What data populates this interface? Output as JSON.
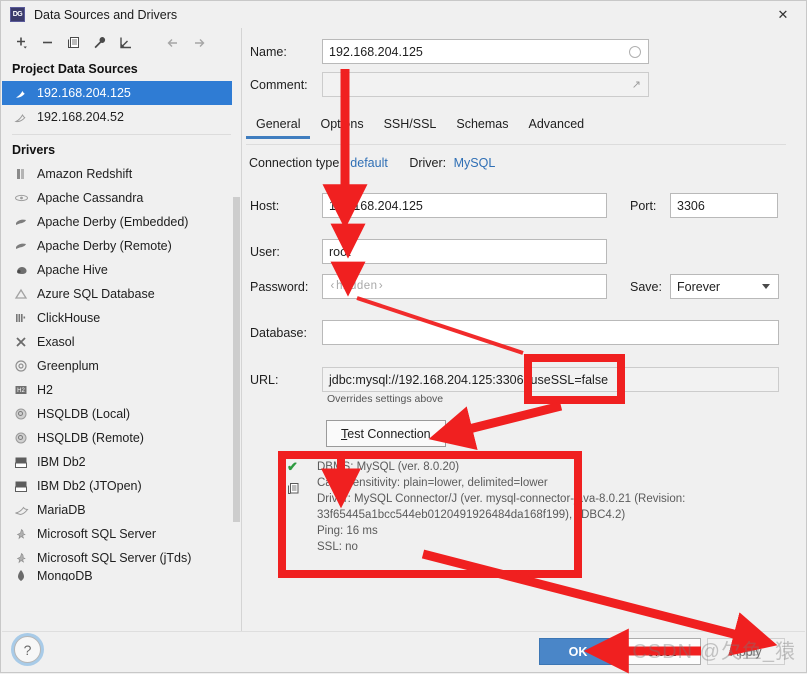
{
  "window": {
    "title": "Data Sources and Drivers",
    "app_icon_label": "DG",
    "close_label": "✕"
  },
  "left_panel": {
    "toolbar": [
      {
        "name": "add-button",
        "glyph": "+"
      },
      {
        "name": "remove-button",
        "glyph": "−"
      },
      {
        "name": "copy-button",
        "glyph": "❐"
      },
      {
        "name": "properties-button",
        "glyph": "🔧"
      },
      {
        "name": "import-button",
        "glyph": "↙"
      },
      {
        "name": "back-button",
        "glyph": "←"
      },
      {
        "name": "forward-button",
        "glyph": "→"
      }
    ],
    "project_data_sources_header": "Project Data Sources",
    "data_sources": [
      {
        "label": "192.168.204.125",
        "selected": true
      },
      {
        "label": "192.168.204.52",
        "selected": false
      }
    ],
    "drivers_header": "Drivers",
    "drivers": [
      {
        "label": "Amazon Redshift",
        "icon": "redshift-icon"
      },
      {
        "label": "Apache Cassandra",
        "icon": "cassandra-icon"
      },
      {
        "label": "Apache Derby (Embedded)",
        "icon": "derby-icon"
      },
      {
        "label": "Apache Derby (Remote)",
        "icon": "derby-icon"
      },
      {
        "label": "Apache Hive",
        "icon": "hive-icon"
      },
      {
        "label": "Azure SQL Database",
        "icon": "azure-icon"
      },
      {
        "label": "ClickHouse",
        "icon": "clickhouse-icon"
      },
      {
        "label": "Exasol",
        "icon": "exasol-icon"
      },
      {
        "label": "Greenplum",
        "icon": "greenplum-icon"
      },
      {
        "label": "H2",
        "icon": "h2-icon"
      },
      {
        "label": "HSQLDB (Local)",
        "icon": "hsqldb-icon"
      },
      {
        "label": "HSQLDB (Remote)",
        "icon": "hsqldb-icon"
      },
      {
        "label": "IBM Db2",
        "icon": "db2-icon"
      },
      {
        "label": "IBM Db2 (JTOpen)",
        "icon": "db2-icon"
      },
      {
        "label": "MariaDB",
        "icon": "mariadb-icon"
      },
      {
        "label": "Microsoft SQL Server",
        "icon": "mssql-icon"
      },
      {
        "label": "Microsoft SQL Server (jTds)",
        "icon": "mssql-icon"
      },
      {
        "label": "MongoDB",
        "icon": "mongodb-icon"
      }
    ]
  },
  "form": {
    "name_label": "Name:",
    "name_value": "192.168.204.125",
    "comment_label": "Comment:",
    "comment_value": "",
    "tabs": [
      {
        "label": "General",
        "active": true
      },
      {
        "label": "Options",
        "active": false
      },
      {
        "label": "SSH/SSL",
        "active": false
      },
      {
        "label": "Schemas",
        "active": false
      },
      {
        "label": "Advanced",
        "active": false
      }
    ],
    "connection_type_label": "Connection type:",
    "connection_type_value": "default",
    "driver_label": "Driver:",
    "driver_value": "MySQL",
    "host_label": "Host:",
    "host_value": "192.168.204.125",
    "port_label": "Port:",
    "port_value": "3306",
    "user_label": "User:",
    "user_value": "root",
    "password_label": "Password:",
    "password_placeholder": "‹hidden›",
    "save_label": "Save:",
    "save_value": "Forever",
    "database_label": "Database:",
    "database_value": "",
    "url_label": "URL:",
    "url_value": "jdbc:mysql://192.168.204.125:3306?useSSL=false",
    "url_hint": "Overrides settings above",
    "test_connection_label": "Test Connection"
  },
  "result": {
    "status_icon": "✔",
    "copy_icon": "❐",
    "lines": [
      "DBMS: MySQL (ver. 8.0.20)",
      "Case sensitivity: plain=lower, delimited=lower",
      "Driver: MySQL Connector/J (ver. mysql-connector-java-8.0.21 (Revision:",
      "33f65445a1bcc544eb0120491926484da168f199), JDBC4.2)",
      "Ping: 16 ms",
      "SSL: no"
    ]
  },
  "footer": {
    "help_label": "?",
    "ok_label": "OK",
    "close_label": "Close",
    "apply_label": "Apply"
  },
  "watermark": "CSDN @欠鱼_猿",
  "colors": {
    "accent": "#2f7cd4",
    "annotation_red": "#f02020",
    "success_green": "#2e9b41",
    "link_blue": "#2f6fb5",
    "primary_button": "#4a86c8"
  }
}
